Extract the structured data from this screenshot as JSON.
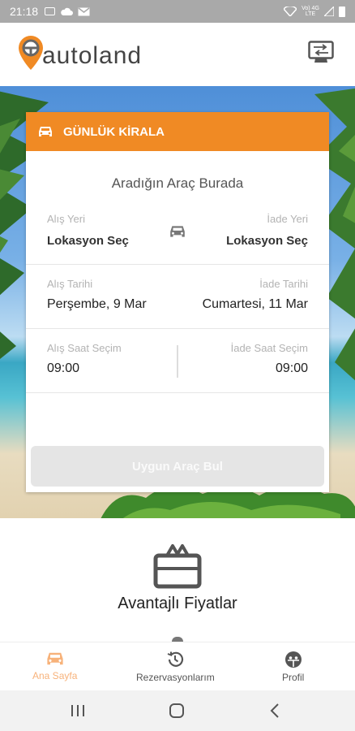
{
  "status_bar": {
    "time": "21:18",
    "net_label": "Vo) 4G LTE"
  },
  "brand": {
    "name": "autoland",
    "accent": "#f08a24"
  },
  "card": {
    "header": "GÜNLÜK KİRALA",
    "subtitle": "Aradığın Araç Burada",
    "pickup_location_label": "Alış Yeri",
    "pickup_location_value": "Lokasyon Seç",
    "return_location_label": "İade Yeri",
    "return_location_value": "Lokasyon Seç",
    "pickup_date_label": "Alış Tarihi",
    "pickup_date_value": "Perşembe, 9 Mar",
    "return_date_label": "İade Tarihi",
    "return_date_value": "Cumartesi, 11 Mar",
    "pickup_time_label": "Alış Saat Seçim",
    "pickup_time_value": "09:00",
    "return_time_label": "İade Saat Seçim",
    "return_time_value": "09:00",
    "find_button": "Uygun Araç Bul"
  },
  "advantages": {
    "title": "Avantajlı Fiyatlar",
    "icon": "gift-icon"
  },
  "bottom_nav": {
    "items": [
      {
        "label": "Ana Sayfa",
        "icon": "car-icon",
        "active": true
      },
      {
        "label": "Rezervasyonlarım",
        "icon": "history-icon",
        "active": false
      },
      {
        "label": "Profil",
        "icon": "profile-icon",
        "active": false
      }
    ]
  },
  "system_nav": [
    "recents-icon",
    "home-icon",
    "back-icon"
  ]
}
